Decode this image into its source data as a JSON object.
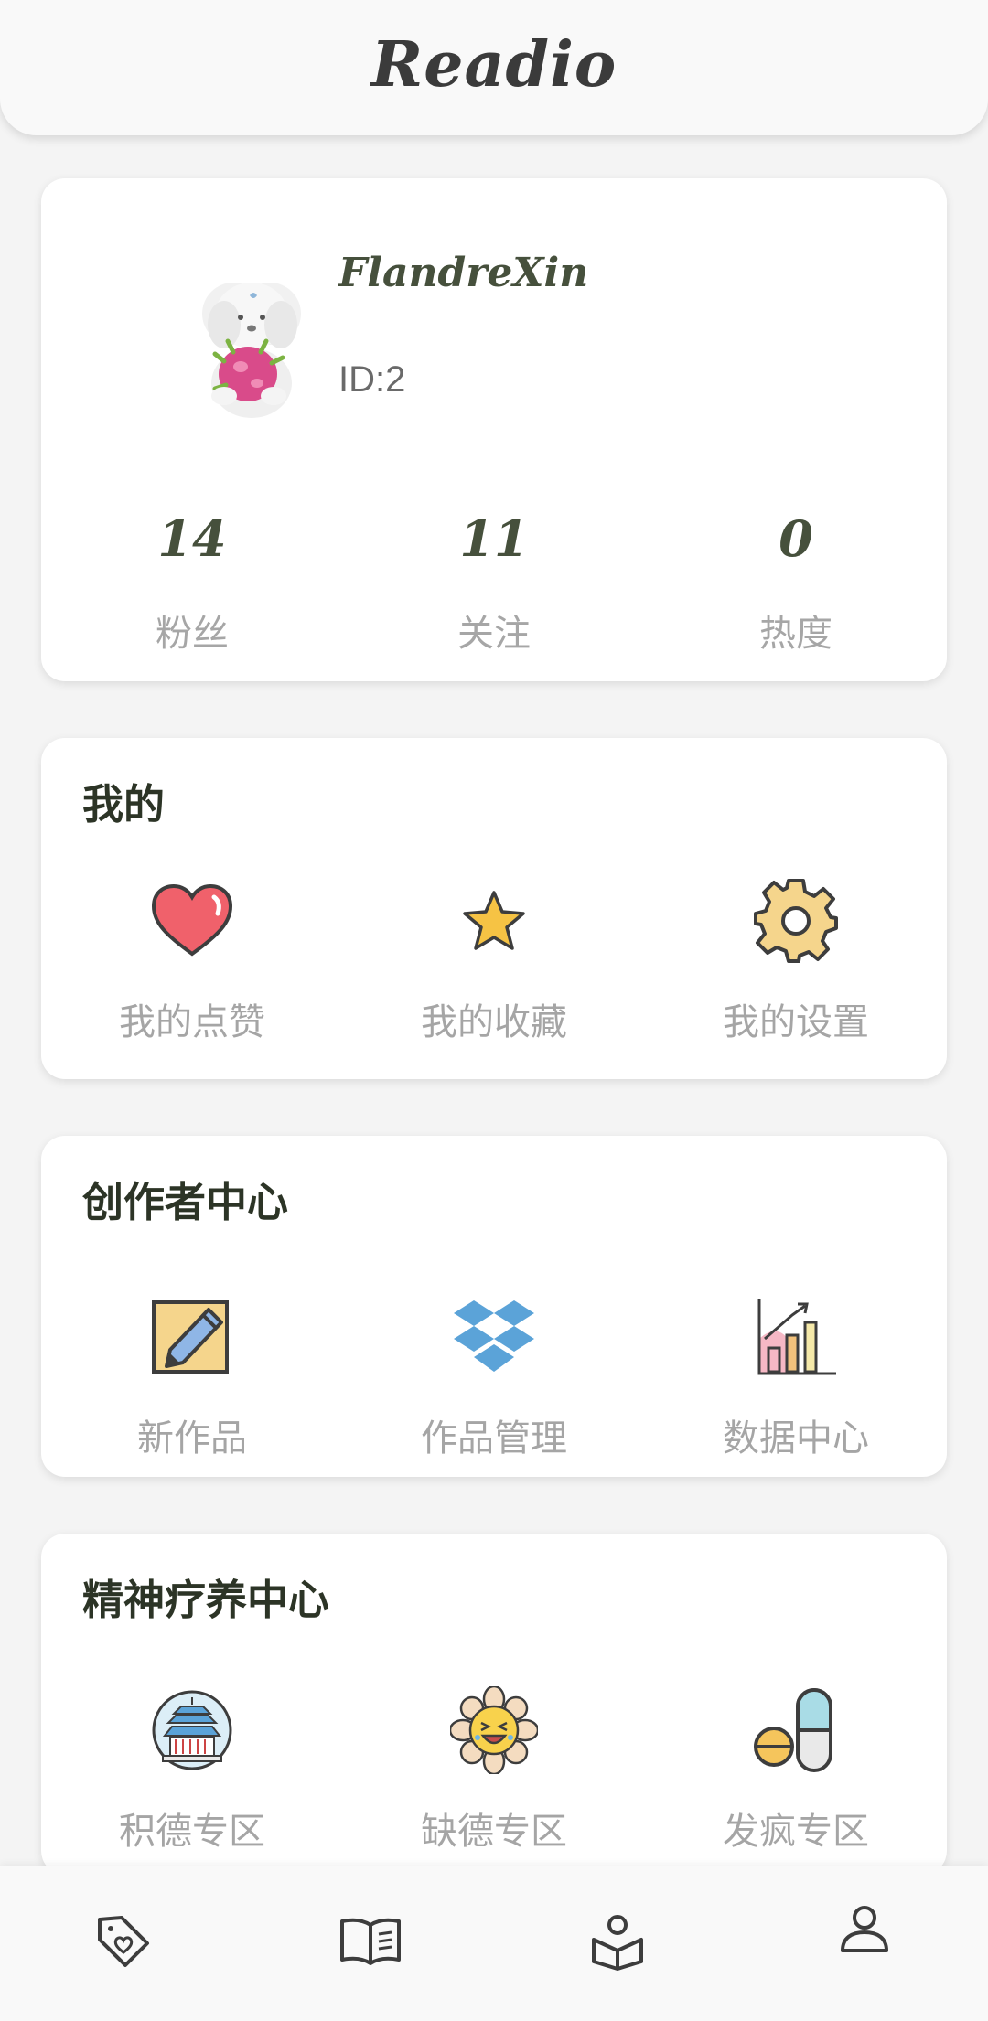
{
  "app": {
    "title": "Readio"
  },
  "profile": {
    "username": "FlandreXin",
    "id_text": "ID:2",
    "stats": [
      {
        "value": "14",
        "label": "粉丝"
      },
      {
        "value": "11",
        "label": "关注"
      },
      {
        "value": "0",
        "label": "热度"
      }
    ]
  },
  "mine": {
    "title": "我的",
    "items": [
      {
        "label": "我的点赞",
        "icon": "heart-icon"
      },
      {
        "label": "我的收藏",
        "icon": "star-icon"
      },
      {
        "label": "我的设置",
        "icon": "gear-icon"
      }
    ]
  },
  "creator": {
    "title": "创作者中心",
    "items": [
      {
        "label": "新作品",
        "icon": "edit-note-icon"
      },
      {
        "label": "作品管理",
        "icon": "dropbox-box-icon"
      },
      {
        "label": "数据中心",
        "icon": "bar-chart-icon"
      }
    ]
  },
  "healing": {
    "title": "精神疗养中心",
    "items": [
      {
        "label": "积德专区",
        "icon": "temple-icon"
      },
      {
        "label": "缺德专区",
        "icon": "laughing-flower-icon"
      },
      {
        "label": "发疯专区",
        "icon": "pills-icon"
      }
    ]
  },
  "nav": {
    "items": [
      {
        "icon": "tag-heart-icon"
      },
      {
        "icon": "open-book-icon"
      },
      {
        "icon": "reader-book-icon"
      },
      {
        "icon": "profile-icon",
        "active": true
      }
    ]
  },
  "colors": {
    "heart": "#f0616b",
    "star": "#f6c344",
    "gear": "#f5d58c",
    "outline": "#3d3d3d",
    "dropbox": "#5ba3d8",
    "chart_pink": "#f6b8c5",
    "pill_blue": "#a9dce6"
  }
}
